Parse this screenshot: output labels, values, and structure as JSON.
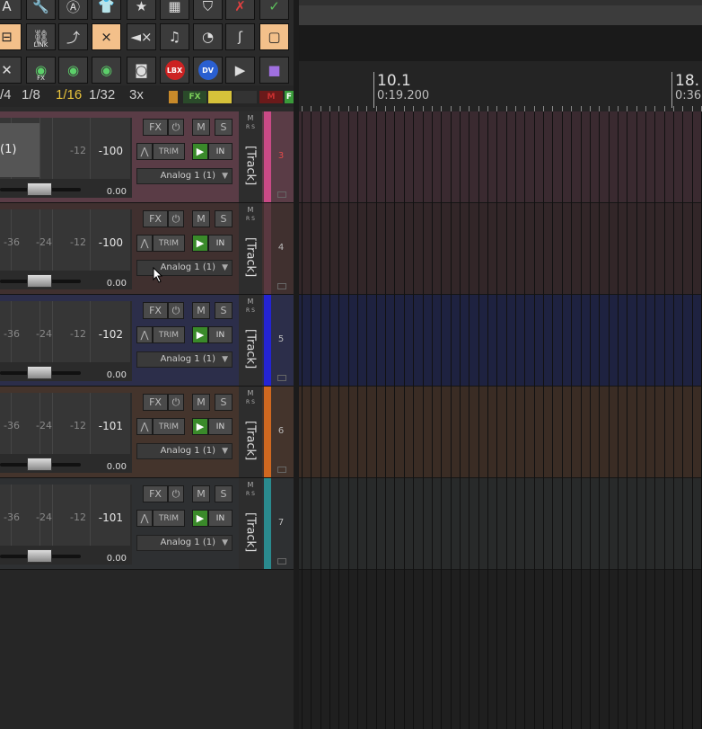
{
  "toolbar": {
    "row1_icons": [
      "font-icon",
      "wrench-icon",
      "anarchy-icon",
      "shirt-icon",
      "star-icon",
      "grid-lines-icon",
      "shield-icon",
      "red-x-icon",
      "checkmark-icon"
    ],
    "row2": [
      {
        "icon": "snap-icon",
        "label": ""
      },
      {
        "icon": "link-icon",
        "label": "LINK"
      },
      {
        "icon": "ripple-icon",
        "label": ""
      },
      {
        "icon": "crossfade-icon",
        "label": ""
      },
      {
        "icon": "mute-env-icon",
        "label": ""
      },
      {
        "icon": "metronome-icon",
        "label": ""
      },
      {
        "icon": "pie-icon",
        "label": ""
      },
      {
        "icon": "lock-curve-icon",
        "label": ""
      },
      {
        "icon": "orange-box-icon",
        "label": ""
      }
    ],
    "row3": [
      {
        "icon": "close-x-icon",
        "label": ""
      },
      {
        "icon": "eye-fx-icon",
        "label": "FX"
      },
      {
        "icon": "eye-icon",
        "label": ""
      },
      {
        "icon": "eye-shuffle-icon",
        "label": ""
      },
      {
        "icon": "speaker-icon",
        "label": ""
      },
      {
        "icon": "lbx-icon",
        "label": "LBX"
      },
      {
        "icon": "dv-icon",
        "label": "DV"
      },
      {
        "icon": "video-icon",
        "label": ""
      },
      {
        "icon": "purple-icon",
        "label": ""
      }
    ]
  },
  "grid": {
    "divisions": [
      "/4",
      "1/8",
      "1/16",
      "1/32",
      "3x"
    ],
    "selected": "1/16",
    "chips": [
      {
        "text": "",
        "color": "#c88a2a"
      },
      {
        "text": "FX",
        "color": "#7ccf5a"
      },
      {
        "text": "",
        "color": "#d6c23a"
      },
      {
        "text": "",
        "color": "#777777"
      },
      {
        "text": "M",
        "color": "#c93030"
      },
      {
        "text": "F",
        "color": "#3a9a3a"
      }
    ]
  },
  "ruler": {
    "marks": [
      {
        "bar": "10.1",
        "time": "0:19.200"
      },
      {
        "bar": "18.",
        "time": "0:36"
      }
    ]
  },
  "tracks": [
    {
      "number": "3",
      "name": "[Track]",
      "peak": "-100",
      "volume": "0.00",
      "input": "Analog 1 (1)",
      "pan": "(1)",
      "color": "#c94a86",
      "lane": "#3a2a30",
      "panel": "#5a3c46",
      "labels": [
        "-12"
      ]
    },
    {
      "number": "4",
      "name": "[Track]",
      "peak": "-100",
      "volume": "0.00",
      "input": "Analog 1 (1)",
      "pan": "",
      "color": "#5a3840",
      "lane": "#322628",
      "panel": "#40302f",
      "labels": [
        "-36",
        "-24",
        "-12"
      ]
    },
    {
      "number": "5",
      "name": "[Track]",
      "peak": "-102",
      "volume": "0.00",
      "input": "Analog 1 (1)",
      "pan": "",
      "color": "#2424d4",
      "lane": "#1e2240",
      "panel": "#2c2e4a",
      "labels": [
        "-36",
        "-24",
        "-12"
      ]
    },
    {
      "number": "6",
      "name": "[Track]",
      "peak": "-101",
      "volume": "0.00",
      "input": "Analog 1 (1)",
      "pan": "",
      "color": "#d06820",
      "lane": "#3a2c24",
      "panel": "#44342c",
      "labels": [
        "-36",
        "-24",
        "-12"
      ]
    },
    {
      "number": "7",
      "name": "[Track]",
      "peak": "-101",
      "volume": "0.00",
      "input": "Analog 1 (1)",
      "pan": "",
      "color": "#2a8a8e",
      "lane": "#282a2a",
      "panel": "#2e3032",
      "labels": [
        "-36",
        "-24",
        "-12"
      ]
    }
  ],
  "buttons": {
    "fx": "FX",
    "mute": "M",
    "solo": "S",
    "trim": "TRIM",
    "in": "IN",
    "ms": "M\nR S"
  }
}
